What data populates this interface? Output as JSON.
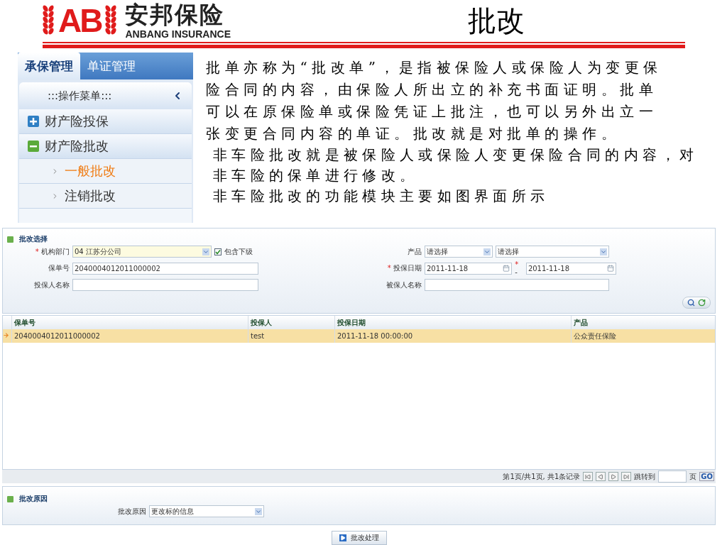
{
  "header": {
    "logo_mark": "AB",
    "logo_name": "安邦保险",
    "logo_subtitle": "ANBANG INSURANCE",
    "title": "批改"
  },
  "menu_panel": {
    "tabs": [
      {
        "label": "承保管理",
        "selected": true
      },
      {
        "label": "单证管理",
        "selected": false
      }
    ],
    "menu_title": ":::操作菜单:::",
    "items": [
      {
        "label": "财产险投保",
        "kind": "group",
        "expanded": false
      },
      {
        "label": "财产险批改",
        "kind": "group",
        "expanded": true
      },
      {
        "label": "一般批改",
        "kind": "leaf",
        "selected": true
      },
      {
        "label": "注销批改",
        "kind": "leaf",
        "selected": false
      }
    ]
  },
  "description": {
    "intro": "批单亦称为“批改单”，是指被保险人或保险人为变更保险合同的内容，由保险人所出立的补充书面证明。批单可以在原保险单或保险凭证上批注，也可以另外出立一张变更合同内容的单证。批改就是对批单的操作。",
    "notes": [
      "非车险批改就是被保险人或保险人变更保险合同的内容，对非车险的保单进行修改。",
      "非车险批改的功能模块主要如图界面所示"
    ]
  },
  "app": {
    "filter": {
      "legend": "批改选择",
      "org": {
        "marker": "*",
        "label": "机构部门",
        "value": "04 江苏分公司",
        "include_sub": {
          "label": "包含下级",
          "checked": true
        }
      },
      "policy_no": {
        "label": "保单号",
        "value": "2040004012011000002"
      },
      "applicant": {
        "label": "投保人名称"
      },
      "product": {
        "label": "产品",
        "selects": [
          "请选择",
          "请选择"
        ]
      },
      "date": {
        "marker": "*",
        "label": "投保日期",
        "from": "2011-11-18",
        "to_marker": "*",
        "separator": "-",
        "to": "2011-11-18"
      },
      "insured": {
        "label": "被保人名称"
      }
    },
    "table": {
      "columns": [
        "保单号",
        "投保人",
        "投保日期",
        "产品"
      ],
      "rows": [
        {
          "cells": [
            "2040004012011000002",
            "test",
            "2011-11-18 00:00:00",
            "公众责任保险"
          ],
          "selected": true
        }
      ]
    },
    "pagination": {
      "summary": "第1页/共1页, 共1条记录",
      "jump_label": "跳转到",
      "page_unit": "页",
      "go": "GO"
    },
    "reason": {
      "legend": "批改原因",
      "label": "批改原因",
      "value": "更改标的信息"
    },
    "submit": "批改处理"
  }
}
